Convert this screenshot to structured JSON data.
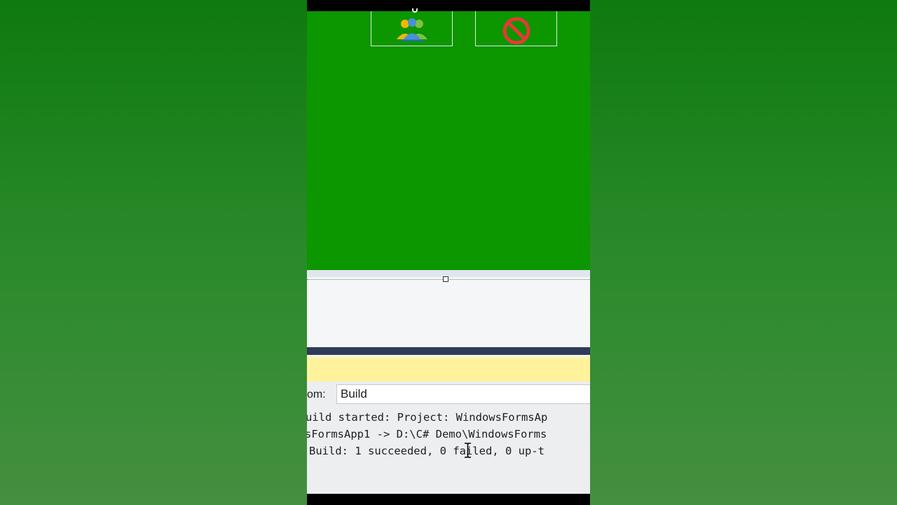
{
  "designer": {
    "buttons": [
      {
        "icon": "users-icon"
      },
      {
        "icon": "prohibited-icon"
      }
    ]
  },
  "output": {
    "show_from_label": "om:",
    "source_value": "Build",
    "lines": [
      "uild started: Project: WindowsFormsAp",
      "sFormsApp1 -> D:\\C# Demo\\WindowsForms",
      "Build: 1 succeeded, 0 failed, 0 up-t"
    ]
  },
  "colors": {
    "form_background": "#0c9600",
    "navy_bar": "#2e3b57",
    "info_bar": "#fff29d",
    "prohibited_red": "#e53935"
  }
}
